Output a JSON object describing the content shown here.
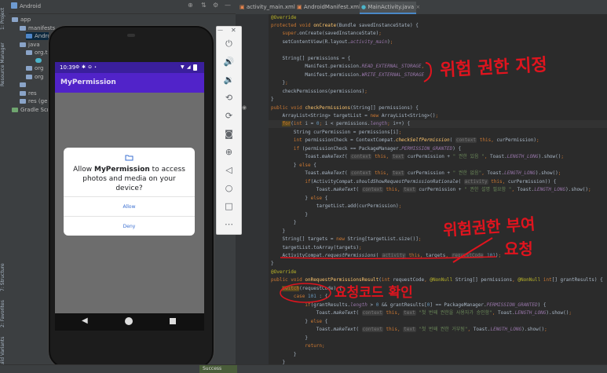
{
  "ide": {
    "project_dropdown": "Android",
    "left_tabs": [
      "1: Project",
      "Resource Manager",
      "7: Structure",
      "2: Favorites",
      "Build Variants"
    ],
    "tree": {
      "app": "app",
      "manifests": "manifests",
      "android_manifest": "AndroidManifest.xml",
      "java": "java",
      "org1": "org.t",
      "org2": "org",
      "org3": "org",
      "res": "res",
      "res_gen": "res (generated)",
      "gradle": "Gradle Scripts"
    },
    "editor_tabs": [
      "activity_main.xml",
      "AndroidManifest.xml",
      "MainActivity.java"
    ],
    "active_tab": 2,
    "status_text": "Success"
  },
  "code": {
    "line_numbers": [
      "",
      "",
      "",
      "",
      "",
      "",
      "",
      "",
      "",
      "",
      "",
      "",
      "",
      "",
      "",
      "",
      "",
      "",
      "",
      "",
      "",
      "",
      "",
      "",
      "",
      "",
      "",
      "",
      "",
      "",
      "",
      "",
      "",
      "",
      "",
      "",
      "",
      "",
      "",
      "",
      "",
      "",
      "",
      "",
      "",
      "",
      ""
    ]
  },
  "annotations": {
    "note1": "위험 권한 지정",
    "note2": "위험권한 부여",
    "note3": "요청",
    "note4": "요청코드 확인"
  },
  "emulator": {
    "time": "10:39",
    "app_title": "MyPermission",
    "dialog_text_pre": "Allow ",
    "dialog_app": "MyPermission",
    "dialog_text_post": " to access photos and media on your device?",
    "allow_label": "Allow",
    "deny_label": "Deny"
  },
  "emu_toolbar": {
    "icons": [
      "power-icon",
      "volume-up-icon",
      "volume-down-icon",
      "rotate-left-icon",
      "rotate-right-icon",
      "camera-icon",
      "zoom-icon",
      "back-icon",
      "home-icon",
      "overview-icon",
      "more-icon"
    ]
  }
}
